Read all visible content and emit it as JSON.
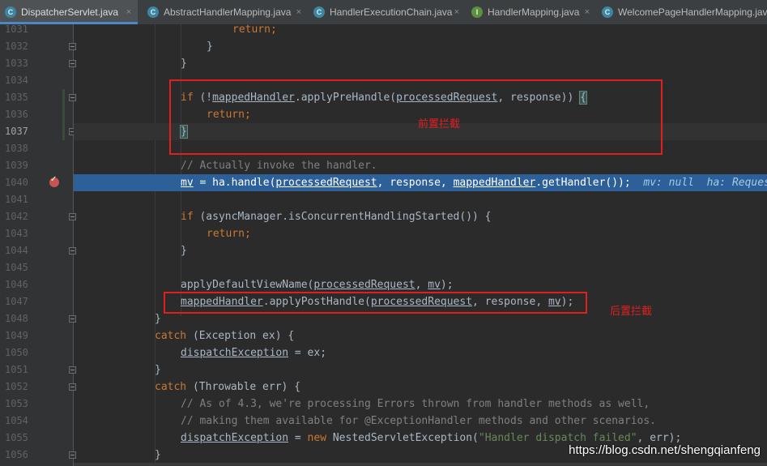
{
  "tabs": [
    {
      "label": "DispatcherServlet.java",
      "icon": "class-icon",
      "active": true
    },
    {
      "label": "AbstractHandlerMapping.java",
      "icon": "class-icon",
      "active": false
    },
    {
      "label": "HandlerExecutionChain.java",
      "icon": "class-icon",
      "active": false
    },
    {
      "label": "HandlerMapping.java",
      "icon": "interface-icon",
      "active": false
    },
    {
      "label": "WelcomePageHandlerMapping.java",
      "icon": "class-icon",
      "active": false
    }
  ],
  "close_glyph": "×",
  "line_numbers": [
    "1031",
    "1032",
    "1033",
    "1034",
    "1035",
    "1036",
    "1037",
    "1038",
    "1039",
    "1040",
    "1041",
    "1042",
    "1043",
    "1044",
    "1045",
    "1046",
    "1047",
    "1048",
    "1049",
    "1050",
    "1051",
    "1052",
    "1053",
    "1054",
    "1055",
    "1056"
  ],
  "code": {
    "l1031": "return",
    "l1032": "}",
    "l1033": "}",
    "l1035_if": "if",
    "l1035_rest1": " (!",
    "l1035_var": "mappedHandler",
    "l1035_rest2": ".applyPreHandle(",
    "l1035_arg": "processedRequest",
    "l1035_rest3": ", response)) ",
    "l1035_brace": "{",
    "l1036_kw": "return",
    "l1037_brace": "}",
    "l1039": "// Actually invoke the handler.",
    "l1040_mv": "mv",
    "l1040_rest1": " = ha.handle(",
    "l1040_arg1": "processedRequest",
    "l1040_rest2": ", response, ",
    "l1040_arg2": "mappedHandler",
    "l1040_rest3": ".getHandler());",
    "l1040_hint": "mv: null  ha: RequestMappingHandlerAdapter",
    "l1042_if": "if",
    "l1042_rest": " (asyncManager.isConcurrentHandlingStarted()) {",
    "l1043_kw": "return",
    "l1044": "}",
    "l1046_fn": "applyDefaultViewName(",
    "l1046_arg1": "processedRequest",
    "l1046_sep": ", ",
    "l1046_arg2": "mv",
    "l1046_end": ");",
    "l1047_var": "mappedHandler",
    "l1047_rest1": ".applyPostHandle(",
    "l1047_arg1": "processedRequest",
    "l1047_rest2": ", response, ",
    "l1047_arg2": "mv",
    "l1047_end": ");",
    "l1048": "}",
    "l1049_kw": "catch",
    "l1049_rest": " (Exception ex) {",
    "l1050_var": "dispatchException",
    "l1050_rest": " = ex;",
    "l1051": "}",
    "l1052_kw": "catch",
    "l1052_rest": " (Throwable err) {",
    "l1053": "// As of 4.3, we're processing Errors thrown from handler methods as well,",
    "l1054": "// making them available for @ExceptionHandler methods and other scenarios.",
    "l1055_var": "dispatchException",
    "l1055_rest1": " = ",
    "l1055_new": "new",
    "l1055_rest2": " NestedServletException(",
    "l1055_str": "\"Handler dispatch failed\"",
    "l1055_rest3": ", err);",
    "l1056": "}",
    "semicolon": ";"
  },
  "annotations": {
    "pre_label": "前置拦截",
    "post_label": "后置拦截"
  },
  "watermark": "https://blog.csdn.net/shengqianfeng",
  "colors": {
    "keyword": "#cc7832",
    "comment": "#808080",
    "string": "#6a8759",
    "exec_line": "#2d6099",
    "annotation": "#e02020"
  }
}
